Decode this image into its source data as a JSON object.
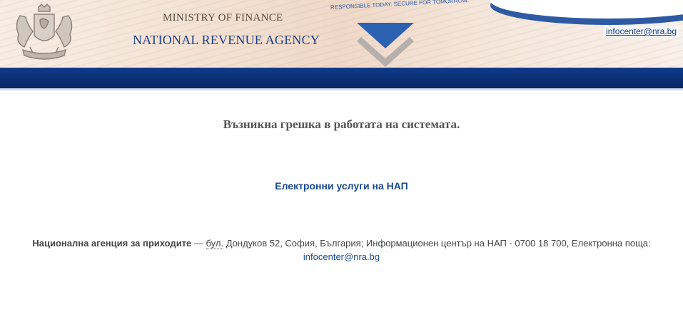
{
  "header": {
    "ministry": "MINISTRY OF FINANCE",
    "agency": "NATIONAL REVENUE AGENCY",
    "slogan": "RESPONSIBLE TODAY. SECURE FOR TOMORROW.",
    "email": "infocenter@nra.bg"
  },
  "main": {
    "error_message": "Възникна грешка в работата на системата.",
    "services_link": "Електронни услуги на НАП"
  },
  "footer": {
    "org_name": "Национална агенция за приходите",
    "dash": " — ",
    "abbr": "бул.",
    "address": " Дондуков 52, София, България; Информационен център на НАП - 0700 18 700, Електронна поща:",
    "email": "infocenter@nra.bg"
  },
  "colors": {
    "brand_blue": "#0f3b8c",
    "link_blue": "#1a4b8f",
    "header_beige": "#f3e2d4"
  },
  "icons": {
    "crest": "coat-of-arms-icon",
    "logo": "nra-v-logo-icon"
  }
}
